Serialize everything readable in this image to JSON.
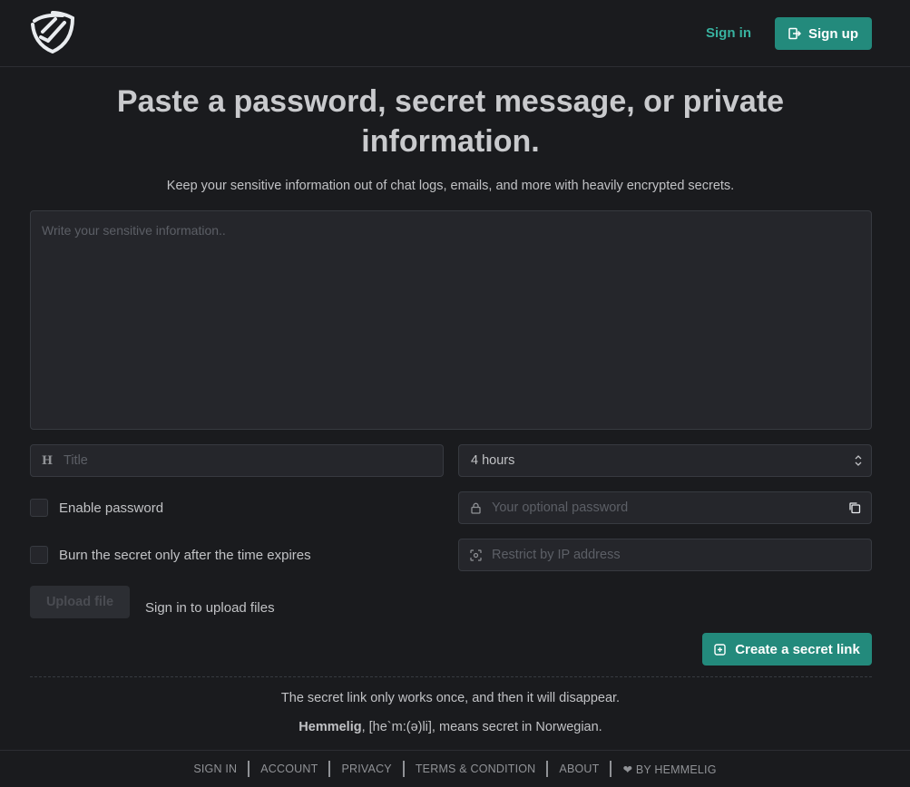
{
  "header": {
    "signin_label": "Sign in",
    "signup_label": "Sign up"
  },
  "hero": {
    "title": "Paste a password, secret message, or private information.",
    "subtitle": "Keep your sensitive information out of chat logs, emails, and more with heavily encrypted secrets."
  },
  "form": {
    "secret_placeholder": "Write your sensitive information..",
    "title_icon": "H",
    "title_placeholder": "Title",
    "ttl_value": "4 hours",
    "enable_password_label": "Enable password",
    "password_placeholder": "Your optional password",
    "burn_label": "Burn the secret only after the time expires",
    "ip_placeholder": "Restrict by IP address",
    "upload_label": "Upload file",
    "upload_hint": "Sign in to upload files",
    "create_label": "Create a secret link"
  },
  "notes": {
    "once": "The secret link only works once, and then it will disappear.",
    "brand": "Hemmelig",
    "pronunciation": ", [he`m:(ə)li], means secret in Norwegian."
  },
  "footer": {
    "links": [
      "SIGN IN",
      "ACCOUNT",
      "PRIVACY",
      "TERMS & CONDITION",
      "ABOUT"
    ],
    "by_label": "BY HEMMELIG"
  },
  "colors": {
    "accent": "#238a7c",
    "background": "#1a1b1e"
  }
}
